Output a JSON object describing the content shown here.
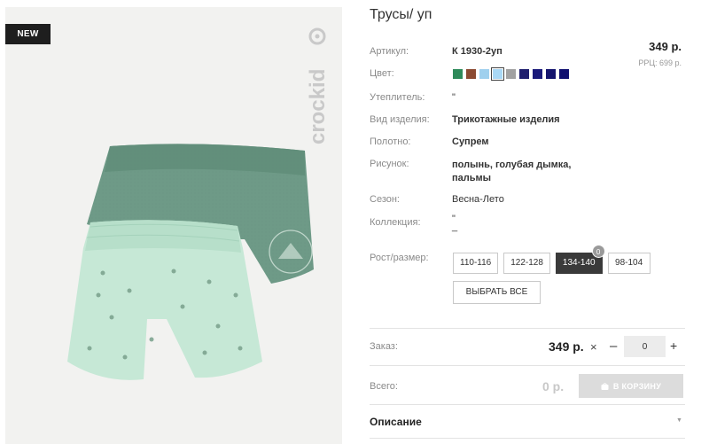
{
  "image": {
    "badge": "NEW",
    "brand": "crockid"
  },
  "product": {
    "title": "Трусы/ уп",
    "price": "349 р.",
    "rrp": "РРЦ: 699 р."
  },
  "attributes": [
    {
      "label": "Артикул:",
      "value": "К 1930-2уп"
    },
    {
      "label": "Цвет:",
      "value": ""
    },
    {
      "label": "Утеплитель:",
      "value": "\""
    },
    {
      "label": "Вид изделия:",
      "value": "Трикотажные изделия"
    },
    {
      "label": "Полотно:",
      "value": "Супрем"
    },
    {
      "label": "Рисунок:",
      "value": "полынь, голубая дымка, пальмы"
    },
    {
      "label": "Сезон:",
      "value": "Весна-Лето"
    },
    {
      "label": "Коллекция:",
      "value": "\"\n_"
    },
    {
      "label": "Рост/размер:",
      "value": ""
    }
  ],
  "colors": [
    "#2e8a5a",
    "#8b4a32",
    "#9fd0ee",
    "#a9d8f5",
    "#a2a2a2",
    "#1f1f6e",
    "#1a1a7a",
    "#14146e",
    "#101070"
  ],
  "selected_color_index": 3,
  "sizes": [
    {
      "label": "110-116",
      "active": false
    },
    {
      "label": "122-128",
      "active": false
    },
    {
      "label": "134-140",
      "active": true,
      "count": "0"
    },
    {
      "label": "98-104",
      "active": false
    }
  ],
  "select_all_label": "ВЫБРАТЬ ВСЕ",
  "order": {
    "label": "Заказ:",
    "price": "349 р.",
    "times": "×",
    "minus": "–",
    "qty": "0",
    "plus": "+"
  },
  "total": {
    "label": "Всего:",
    "value": "0 р.",
    "cart_button": "В КОРЗИНУ"
  },
  "description": {
    "label": "Описание",
    "caret": "▼"
  }
}
